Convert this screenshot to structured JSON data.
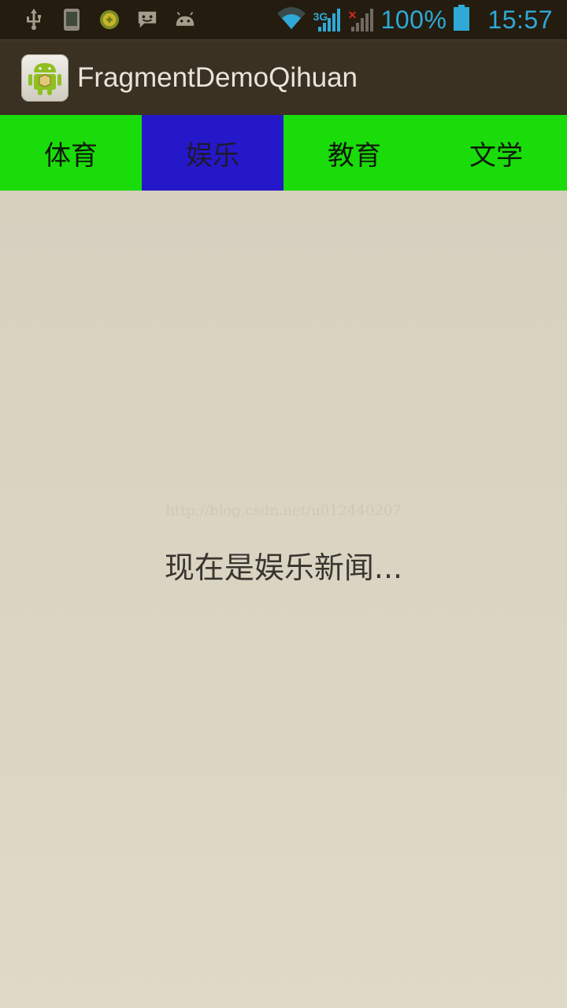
{
  "status_bar": {
    "icons": [
      "usb-icon",
      "phone-icon",
      "game-icon",
      "message-icon",
      "android-icon",
      "wifi-icon",
      "signal-icon",
      "signal-empty-icon",
      "battery-icon"
    ],
    "network_type": "3G",
    "battery": "100%",
    "time": "15:57",
    "accent_color": "#2fa9d8"
  },
  "action_bar": {
    "title": "FragmentDemoQihuan",
    "icon": "android-app-icon"
  },
  "tabs": [
    {
      "label": "体育",
      "active": false
    },
    {
      "label": "娱乐",
      "active": true
    },
    {
      "label": "教育",
      "active": false
    },
    {
      "label": "文学",
      "active": false
    }
  ],
  "colors": {
    "tab_bg": "#1adc0b",
    "tab_active_bg": "#2518c8",
    "content_bg": "#dcd6c4"
  },
  "content": {
    "watermark": "http://blog.csdn.net/u012440207",
    "message": "现在是娱乐新闻..."
  }
}
